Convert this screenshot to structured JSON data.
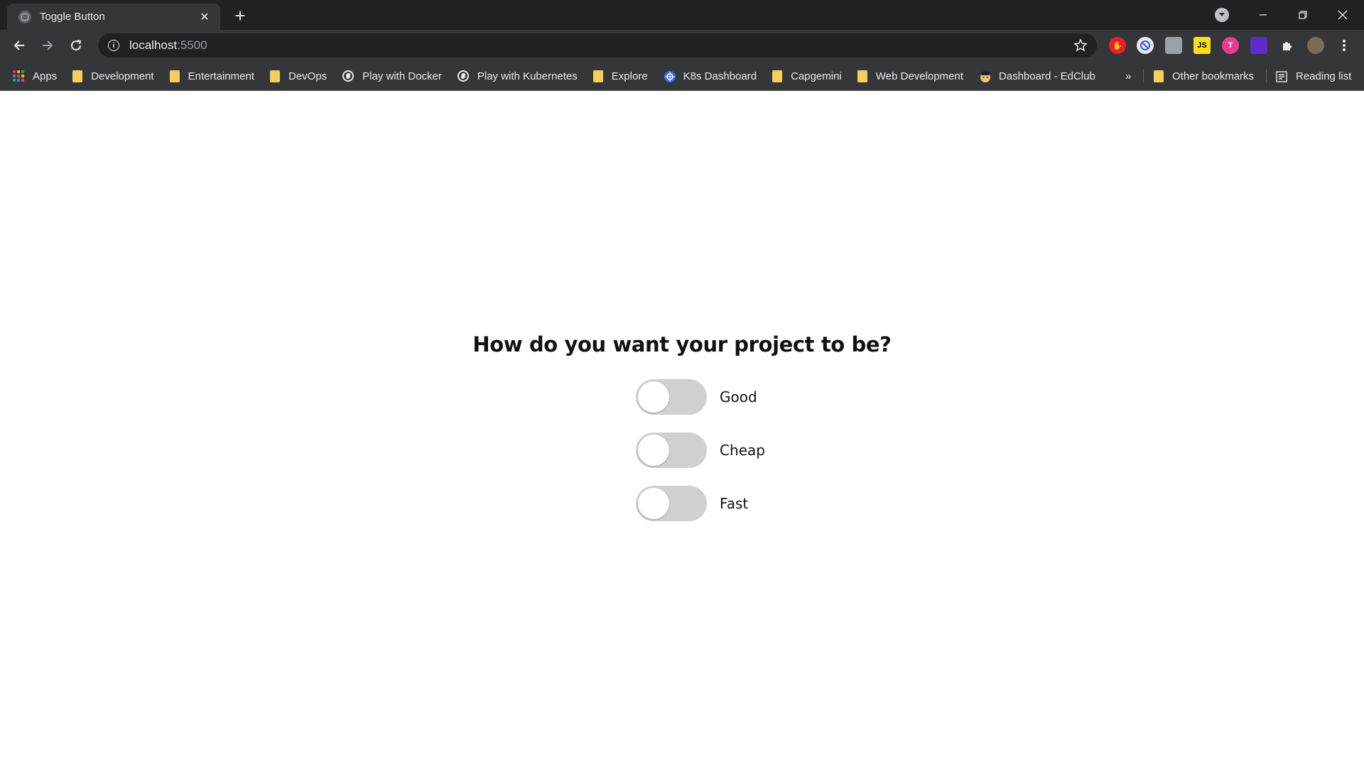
{
  "tab": {
    "title": "Toggle Button",
    "close_glyph": "✕"
  },
  "new_tab_glyph": "+",
  "address": {
    "host": "localhost",
    "port": ":5500"
  },
  "bookmarks": {
    "apps": "Apps",
    "items": [
      {
        "label": "Development",
        "icon": "folder-icon"
      },
      {
        "label": "Entertainment",
        "icon": "folder-icon"
      },
      {
        "label": "DevOps",
        "icon": "folder-icon"
      },
      {
        "label": "Play with Docker",
        "icon": "globe-icon"
      },
      {
        "label": "Play with Kubernetes",
        "icon": "globe-icon"
      },
      {
        "label": "Explore",
        "icon": "folder-icon"
      },
      {
        "label": "K8s Dashboard",
        "icon": "kubernetes-icon"
      },
      {
        "label": "Capgemini",
        "icon": "folder-icon"
      },
      {
        "label": "Web Development",
        "icon": "folder-icon"
      },
      {
        "label": "Dashboard - EdClub",
        "icon": "edclub-icon"
      }
    ],
    "overflow_glyph": "»",
    "other_bookmarks": "Other bookmarks",
    "reading_list": "Reading list"
  },
  "page": {
    "heading": "How do you want your project to be?",
    "toggles": [
      {
        "label": "Good",
        "checked": false
      },
      {
        "label": "Cheap",
        "checked": false
      },
      {
        "label": "Fast",
        "checked": false
      }
    ]
  },
  "colors": {
    "tabstrip_bg": "#202124",
    "toolbar_bg": "#35363a",
    "switch_off": "#d0d0d0",
    "knob": "#ffffff"
  }
}
